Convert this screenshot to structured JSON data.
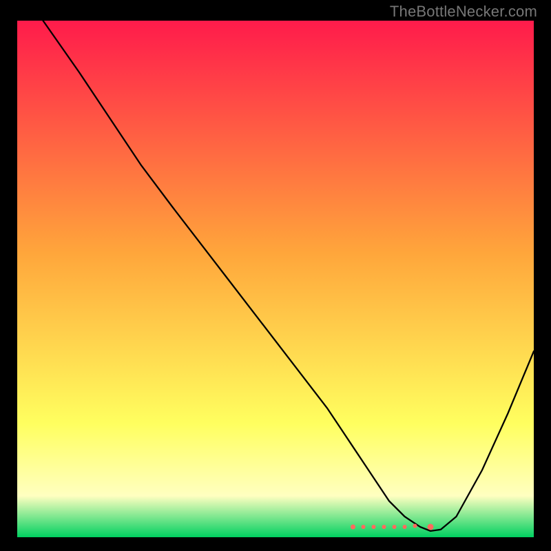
{
  "watermark": "TheBottleNecker.com",
  "chart_data": {
    "type": "line",
    "title": "",
    "xlabel": "",
    "ylabel": "",
    "xlim": [
      0,
      100
    ],
    "ylim": [
      0,
      100
    ],
    "grid": false,
    "gradient_colors": {
      "top": "#ff1b4b",
      "mid1": "#ffa63b",
      "mid2": "#ffff5f",
      "mid3": "#ffffc0",
      "bottom": "#00d060"
    },
    "series": [
      {
        "name": "bottleneck-curve",
        "color": "#000000",
        "stroke_width": 2.3,
        "x": [
          5,
          12,
          20,
          24,
          30,
          40,
          50,
          60,
          68,
          72,
          75,
          78,
          80,
          82,
          85,
          90,
          95,
          100
        ],
        "y": [
          100,
          90,
          78,
          72,
          64,
          51,
          38,
          25,
          13,
          7,
          4,
          2,
          1.2,
          1.5,
          4,
          13,
          24,
          36
        ]
      }
    ],
    "markers": {
      "color": "#ff6a5e",
      "points_x": [
        65,
        67,
        69,
        71,
        73,
        75,
        77,
        80
      ],
      "points_y": [
        2.0,
        2.0,
        2.0,
        2.0,
        2.0,
        2.0,
        2.2,
        2.0
      ],
      "radii": [
        3.5,
        3.0,
        3.0,
        3.0,
        3.0,
        3.0,
        3.0,
        4.5
      ]
    }
  }
}
